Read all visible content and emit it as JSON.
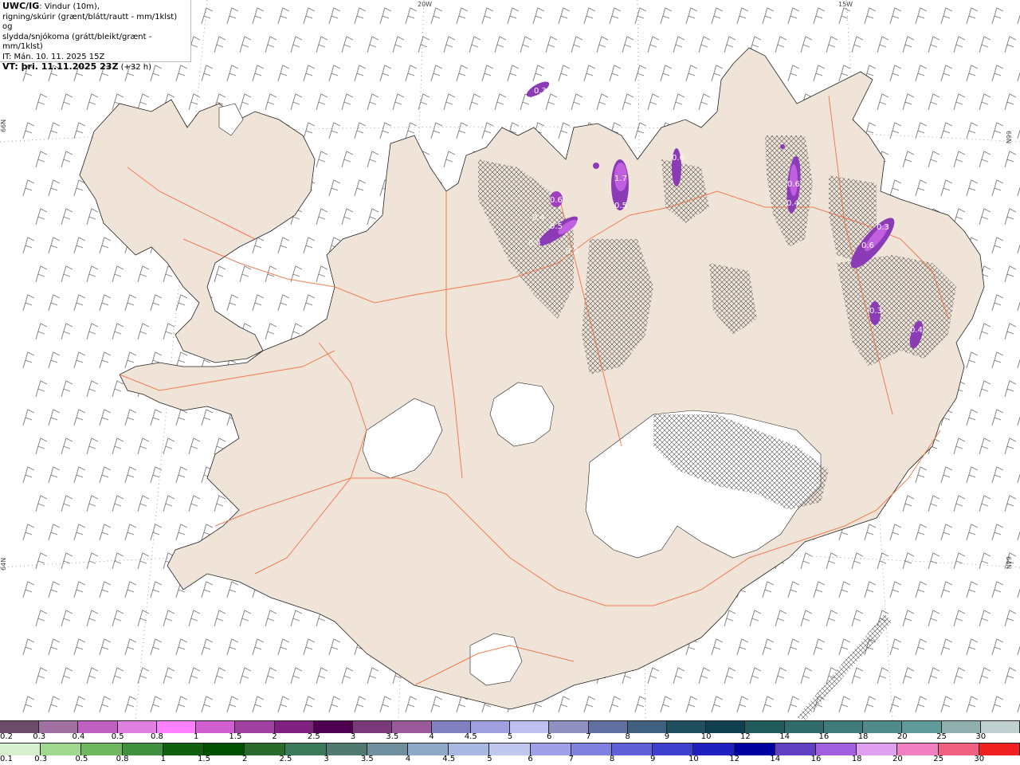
{
  "header": {
    "title_bold": "UWC/IG",
    "title_rest": ": Vindur (10m),",
    "line2": "rigning/skúrir (grænt/blátt/rautt - mm/1klst) og",
    "line3": "slydda/snjókoma (grátt/bleikt/grænt - mm/1klst)",
    "line4": "IT: Mán. 10. 11. 2025 15Z",
    "line5_bold": "VT: þri. 11.11.2025 23Z",
    "line5_rest": " (+32 h)"
  },
  "graticule": {
    "top_labels": [
      "20W",
      "15W"
    ],
    "left_labels": [
      "66N",
      "64N"
    ],
    "right_labels": [
      "66N",
      "64N"
    ]
  },
  "colors": {
    "land": "#f0e4d8",
    "ice": "#ffffff",
    "roads": "#ee6a3a",
    "coast": "#222222",
    "precip": "#8a3bb5",
    "precip_core": "#c060e0",
    "hatch": "#555555",
    "barbs": "#777777"
  },
  "precip_labels": [
    "0.3",
    "0.6",
    "0.4",
    "0.5",
    "0.3",
    "0.4",
    "1.7",
    "0.5",
    "0.6",
    "0.6",
    "0.4",
    "0.3",
    "0.6",
    "0.3",
    "0.4"
  ],
  "scale_top": {
    "labels": [
      "0.2",
      "0.3",
      "0.4",
      "0.5",
      "0.8",
      "1",
      "1.5",
      "2",
      "2.5",
      "3",
      "3.5",
      "4",
      "4.5",
      "5",
      "6",
      "7",
      "8",
      "9",
      "10",
      "12",
      "14",
      "16",
      "18",
      "20",
      "25",
      "30"
    ],
    "colors": [
      "#6b4a6a",
      "#a070a0",
      "#c060c0",
      "#e080e0",
      "#ff80ff",
      "#d060d0",
      "#a040a0",
      "#802080",
      "#500050",
      "#7a3a7a",
      "#9a5a9a",
      "#8080c0",
      "#a0a0e0",
      "#c0c0f0",
      "#9090c0",
      "#6070a0",
      "#406080",
      "#205060",
      "#104050",
      "#205a5a",
      "#306a6a",
      "#407a7a",
      "#508a8a",
      "#609a9a",
      "#90b0b0",
      "#c0d0d0"
    ]
  },
  "scale_bottom": {
    "labels": [
      "0.1",
      "0.3",
      "0.5",
      "0.8",
      "1",
      "1.5",
      "2",
      "2.5",
      "3",
      "3.5",
      "4",
      "4.5",
      "5",
      "6",
      "7",
      "8",
      "9",
      "10",
      "12",
      "14",
      "16",
      "18",
      "20",
      "25",
      "30"
    ],
    "colors": [
      "#d8f0d0",
      "#a0d890",
      "#70b860",
      "#409040",
      "#106010",
      "#005000",
      "#2a6a2a",
      "#3a7a5a",
      "#507a70",
      "#7090a0",
      "#90a8c8",
      "#a8b8e0",
      "#c0c8f0",
      "#a0a0e8",
      "#8080e0",
      "#6060d8",
      "#4040d0",
      "#2020c0",
      "#0000a0",
      "#6040c0",
      "#a060e0",
      "#e0a0f0",
      "#f080c0",
      "#f06080",
      "#f02020"
    ]
  }
}
